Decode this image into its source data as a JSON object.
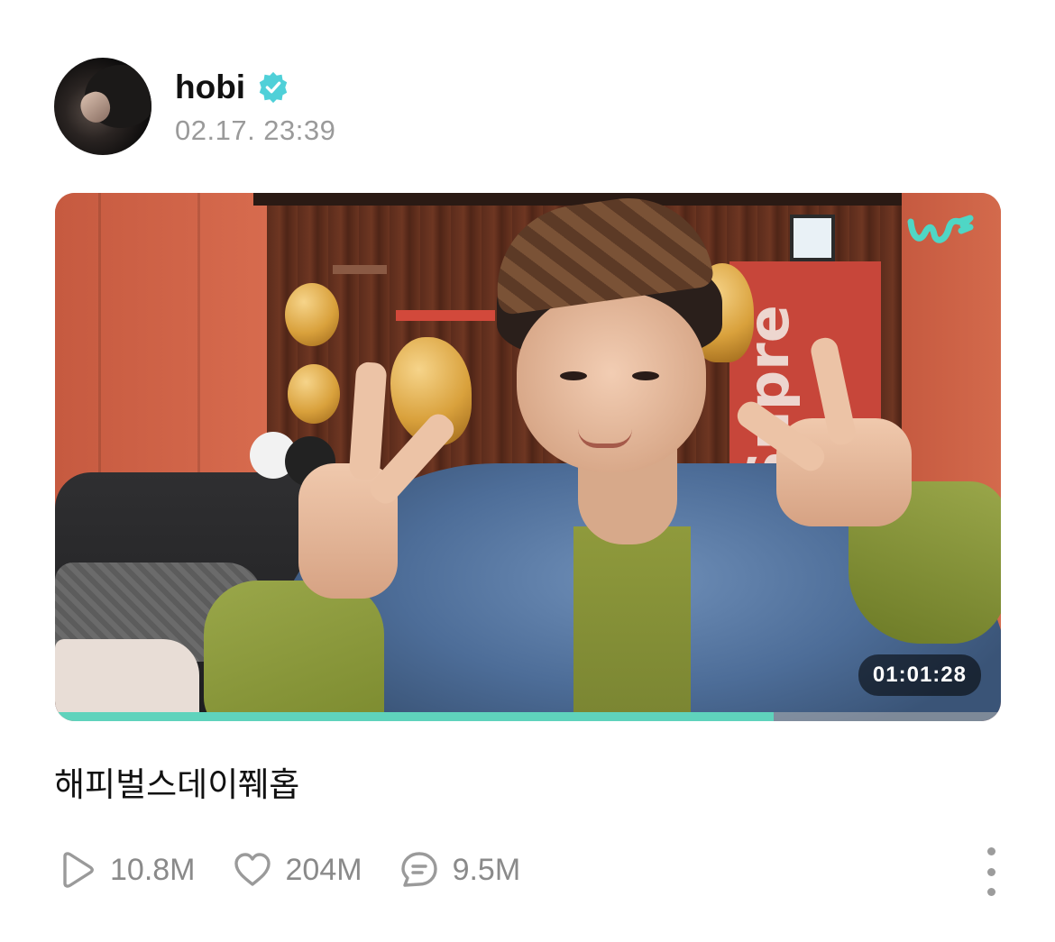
{
  "author": {
    "name": "hobi",
    "verified": true,
    "timestamp": "02.17. 23:39",
    "avatar_icon": "profile-avatar"
  },
  "video": {
    "duration": "01:01:28",
    "progress_percent": 76,
    "logo_icon": "weverse-logo",
    "progress_color": "#5fd3bc"
  },
  "post": {
    "caption": "해피벌스데이쮀홉"
  },
  "stats": {
    "plays": "10.8M",
    "likes": "204M",
    "comments": "9.5M"
  },
  "colors": {
    "verified_badge": "#4fd0d8",
    "accent": "#5fd3bc",
    "muted_text": "#9a9a9a"
  }
}
